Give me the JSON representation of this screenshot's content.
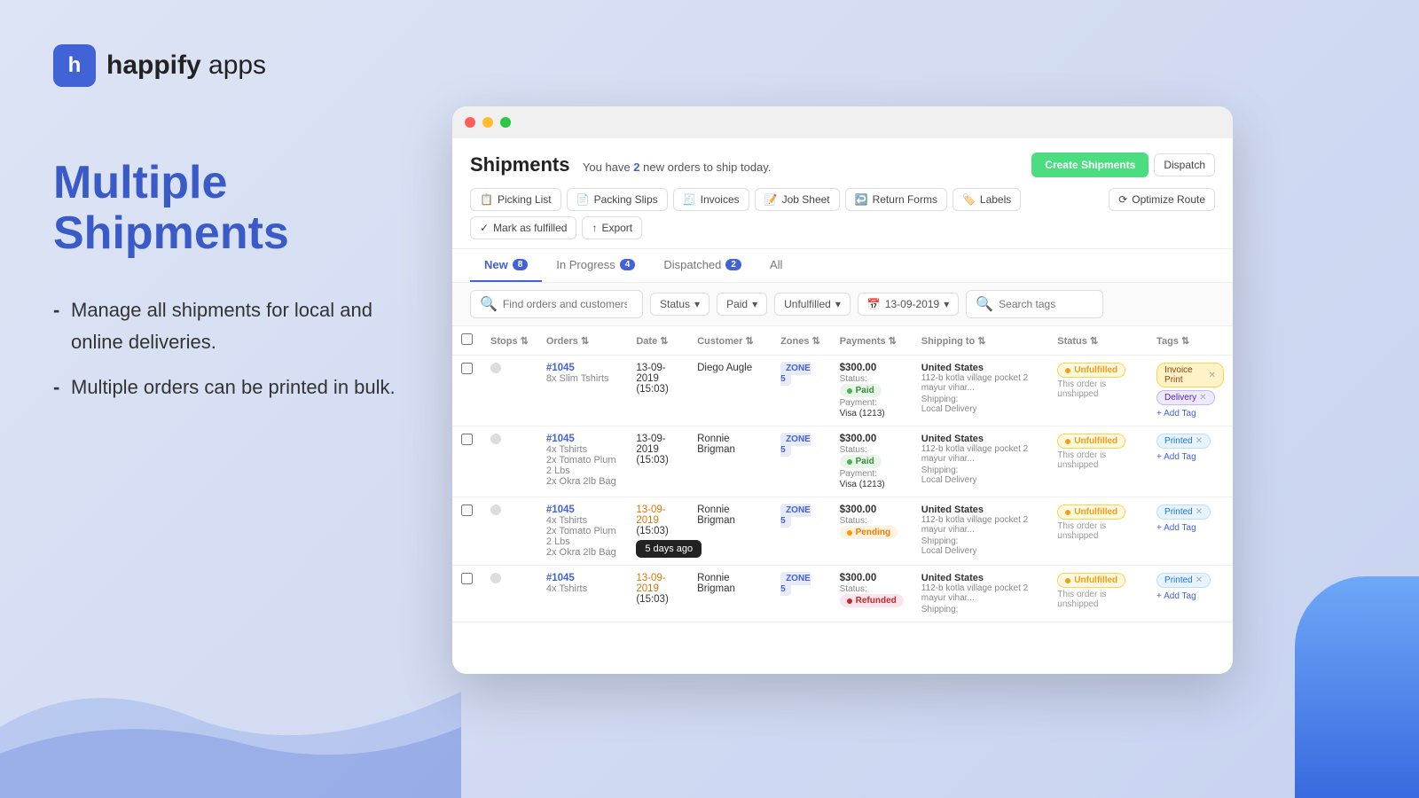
{
  "brand": {
    "icon": "h",
    "name_bold": "happify",
    "name_light": " apps"
  },
  "hero": {
    "headline": "Multiple Shipments",
    "bullets": [
      "Manage all shipments for local and online deliveries.",
      "Multiple orders can be printed in bulk."
    ]
  },
  "window": {
    "title": "Shipments",
    "notice": "You have",
    "notice_count": "2",
    "notice_suffix": "new orders to ship today.",
    "toolbar": [
      {
        "icon": "📋",
        "label": "Picking List"
      },
      {
        "icon": "📄",
        "label": "Packing Slips"
      },
      {
        "icon": "🧾",
        "label": "Invoices"
      },
      {
        "icon": "📝",
        "label": "Job Sheet"
      },
      {
        "icon": "↩️",
        "label": "Return Forms"
      },
      {
        "icon": "🏷️",
        "label": "Labels"
      }
    ],
    "action_buttons": [
      {
        "label": "Optimize Route"
      },
      {
        "label": "Mark as fulfilled"
      },
      {
        "label": "Export"
      }
    ],
    "create_btn": "Create Shipments",
    "dispatch_btn": "Dispatch",
    "tabs": [
      {
        "label": "New",
        "badge": "8",
        "active": true
      },
      {
        "label": "In Progress",
        "badge": "4",
        "active": false
      },
      {
        "label": "Dispatched",
        "badge": "2",
        "active": false
      },
      {
        "label": "All",
        "badge": "",
        "active": false
      }
    ],
    "filters": {
      "search_placeholder": "Find orders and customers",
      "status_label": "Status",
      "paid_label": "Paid",
      "unfulfilled_label": "Unfulfilled",
      "date_label": "13-09-2019",
      "tags_placeholder": "Search tags"
    },
    "table": {
      "columns": [
        "",
        "",
        "Orders",
        "Date",
        "Customer",
        "Zones",
        "Payments",
        "Shipping to",
        "Status",
        "Tags"
      ],
      "rows": [
        {
          "order_id": "#1045",
          "items": "8x Slim Tshirts",
          "date": "13-09-2019",
          "time": "(15:03)",
          "customer": "Diego Augle",
          "zone": "ZONE 5",
          "amount": "$300.00",
          "pay_status": "Paid",
          "payment_method": "Visa (1213)",
          "address_main": "United States",
          "address_sub": "112-b kotla village pocket 2 mayur vihar...",
          "shipping": "Local Delivery",
          "fulfill_status": "Unfulfilled",
          "unshipped_msg": "This order is unshipped",
          "tags": [
            {
              "label": "Invoice Print",
              "type": "invoice"
            },
            {
              "label": "Delivery",
              "type": "delivery"
            }
          ]
        },
        {
          "order_id": "#1045",
          "items": "4x Tshirts\n2x Tomato Plum 2 Lbs\n2x Okra 2lb Bag",
          "date": "13-09-2019",
          "time": "(15:03)",
          "customer": "Ronnie Brigman",
          "zone": "ZONE 5",
          "amount": "$300.00",
          "pay_status": "Paid",
          "payment_method": "Visa (1213)",
          "address_main": "United States",
          "address_sub": "112-b kotla village pocket 2 mayur vihar...",
          "shipping": "Local Delivery",
          "fulfill_status": "Unfulfilled",
          "unshipped_msg": "This order is unshipped",
          "tags": [
            {
              "label": "Printed",
              "type": "printed"
            }
          ]
        },
        {
          "order_id": "#1045",
          "items": "4x Tshirts\n2x Tomato Plum 2 Lbs\n2x Okra 2lb Bag",
          "date": "13-09-2019",
          "time": "(15:03)",
          "date_tooltip": "5 days ago",
          "customer": "Ronnie Brigman",
          "zone": "ZONE 5",
          "amount": "$300.00",
          "pay_status": "Pending",
          "payment_method": "",
          "address_main": "United States",
          "address_sub": "112-b kotla village pocket 2 mayur vihar...",
          "shipping": "Local Delivery",
          "fulfill_status": "Unfulfilled",
          "unshipped_msg": "This order is unshipped",
          "tags": [
            {
              "label": "Printed",
              "type": "printed"
            }
          ]
        },
        {
          "order_id": "#1045",
          "items": "4x Tshirts",
          "date": "13-09-2019",
          "time": "(15:03)",
          "customer": "Ronnie Brigman",
          "zone": "ZONE 5",
          "amount": "$300.00",
          "pay_status": "Refunded",
          "payment_method": "",
          "address_main": "United States",
          "address_sub": "112-b kotla village pocket 2 mayur vihar...",
          "shipping": "",
          "fulfill_status": "Unfulfilled",
          "unshipped_msg": "This order is unshipped",
          "tags": [
            {
              "label": "Printed",
              "type": "printed"
            }
          ]
        }
      ]
    }
  }
}
